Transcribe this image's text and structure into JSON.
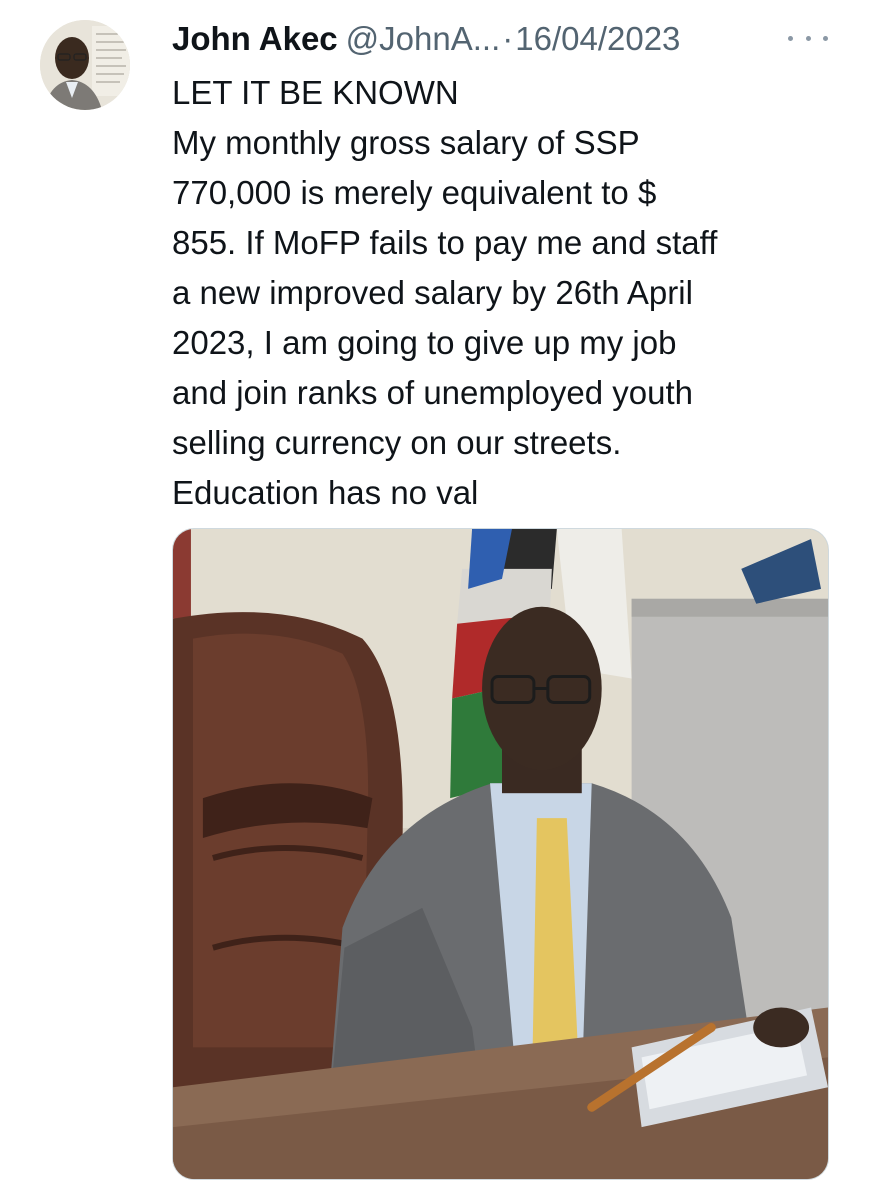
{
  "author": {
    "display_name": "John Akec",
    "handle": "@JohnA...",
    "separator": "·",
    "date": "16/04/2023"
  },
  "more_icon": "more-horizontal-icon",
  "tweet": {
    "lines": [
      "LET IT BE KNOWN",
      "My monthly gross salary of SSP",
      "770,000 is merely equivalent to $",
      "855. If MoFP fails to pay me and staff",
      "a new improved salary by 26th April",
      "2023, I am going to give up my job",
      "and join ranks of unemployed youth",
      "selling currency on our streets.",
      "Education has no val"
    ]
  },
  "colors": {
    "text": "#0f1419",
    "secondary": "#536471",
    "border": "#cfd9de"
  }
}
